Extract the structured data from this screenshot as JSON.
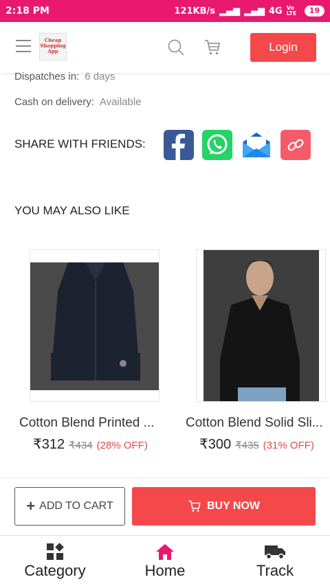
{
  "status_bar": {
    "time": "2:18 PM",
    "speed": "121KB/s",
    "network": "4G",
    "volte": "Vo LTE",
    "battery": "19"
  },
  "header": {
    "logo_text": "Cheap Shopping App",
    "login_label": "Login"
  },
  "product_info": {
    "dispatch_label": "Dispatches in:",
    "dispatch_value": "6 days",
    "cod_label": "Cash on delivery:",
    "cod_value": "Available"
  },
  "share": {
    "label": "SHARE WITH FRIENDS:",
    "icons": [
      "facebook-icon",
      "whatsapp-icon",
      "email-icon",
      "link-icon"
    ],
    "colors": {
      "facebook": "#3b5998",
      "whatsapp": "#25d366",
      "email": "#1e88e5",
      "link": "#f45b69"
    }
  },
  "recommendations": {
    "title": "YOU MAY ALSO LIKE",
    "items": [
      {
        "title": "Cotton Blend Printed ...",
        "price": "₹312",
        "mrp": "₹434",
        "discount": "(28% OFF)"
      },
      {
        "title": "Cotton Blend Solid Sli...",
        "price": "₹300",
        "mrp": "₹435",
        "discount": "(31% OFF)"
      }
    ]
  },
  "actions": {
    "add_to_cart": "ADD TO CART",
    "buy_now": "BUY NOW"
  },
  "bottom_nav": [
    {
      "label": "Category",
      "icon": "category-icon"
    },
    {
      "label": "Home",
      "icon": "home-icon"
    },
    {
      "label": "Track",
      "icon": "truck-icon"
    }
  ],
  "colors": {
    "accent": "#e8196e",
    "button": "#f5484b",
    "discount": "#e04b4b"
  }
}
